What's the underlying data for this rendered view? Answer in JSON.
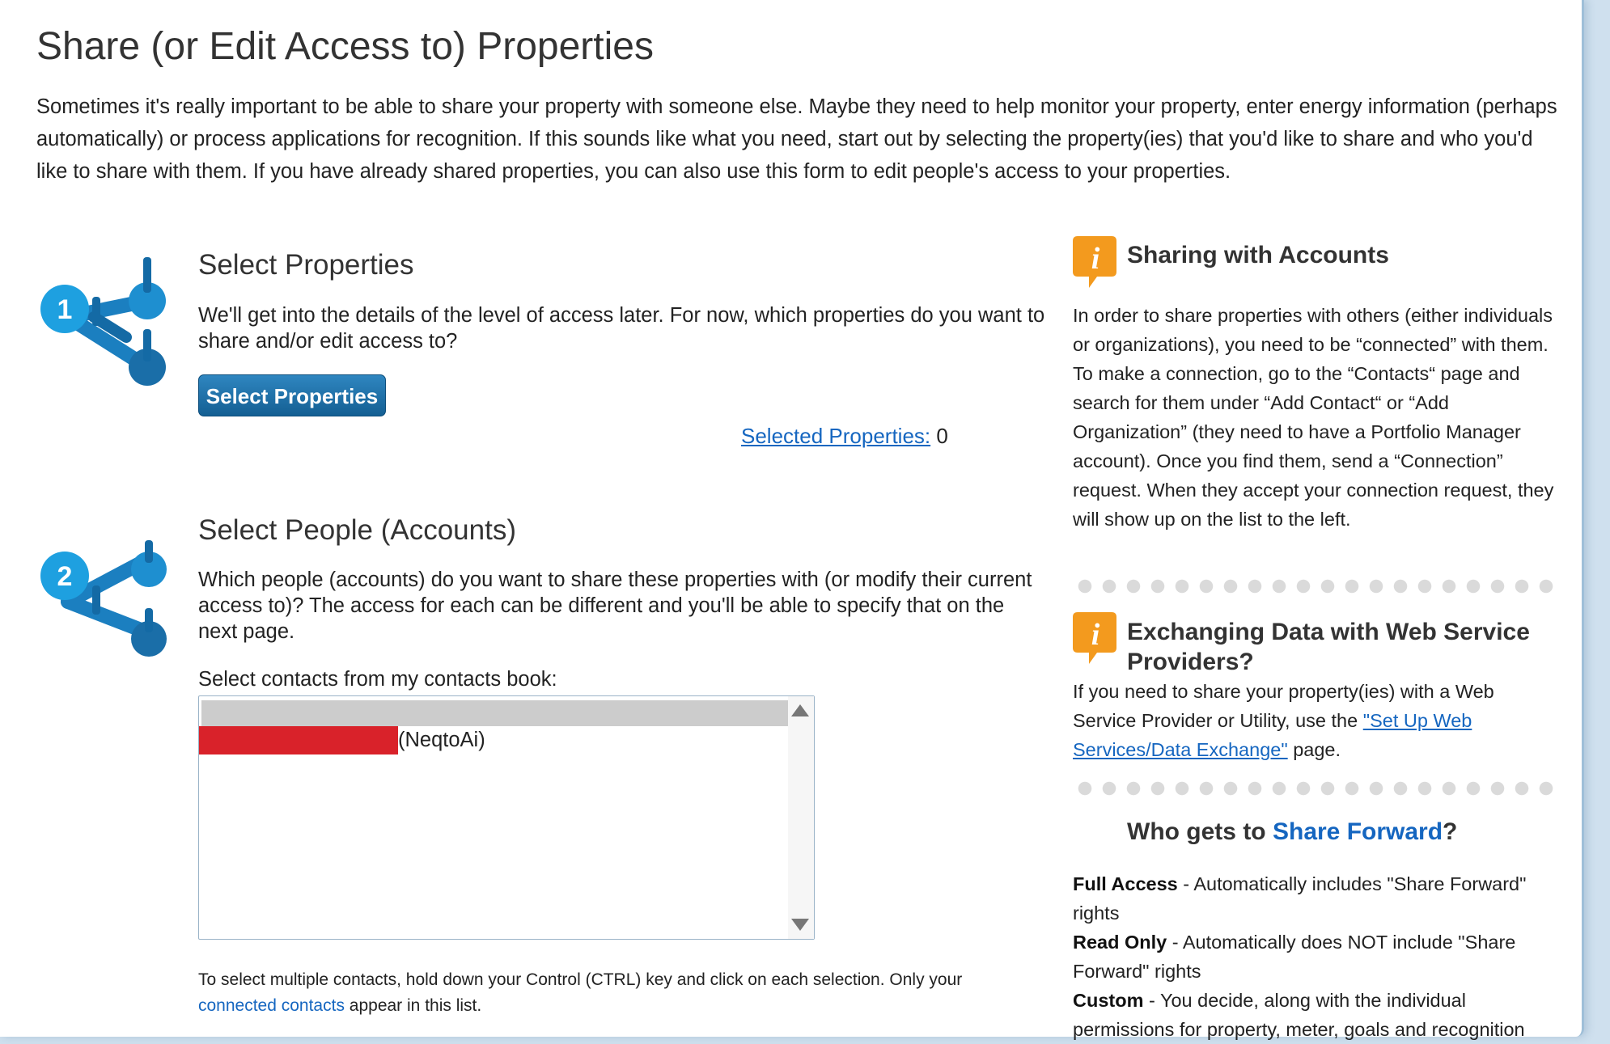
{
  "page": {
    "title": "Share (or Edit Access to) Properties",
    "intro": "Sometimes it's really important to be able to share your property with someone else. Maybe they need to help monitor your property, enter energy information (perhaps automatically) or process applications for recognition. If this sounds like what you need, start out by selecting the property(ies) that you'd like to share and who you'd like to share with them. If you have already shared properties, you can also use this form to edit people's access to your properties."
  },
  "step1": {
    "number": "1",
    "title": "Select Properties",
    "text": "We'll get into the details of the level of access later. For now, which properties do you want to share and/or edit access to?",
    "button_label": "Select Properties",
    "selected_link": "Selected Properties:",
    "selected_count": "0"
  },
  "step2": {
    "number": "2",
    "title": "Select People (Accounts)",
    "text": "Which people (accounts) do you want to share these properties with (or modify their current access to)? The access for each can be different and you'll be able to specify that on the next page.",
    "contacts_label": "Select contacts from my contacts book:",
    "contacts": [
      {
        "label": "(NeqtoAi)"
      }
    ],
    "footnote_before": "To select multiple contacts, hold down your Control (CTRL) key and click on each selection. Only your ",
    "footnote_link": "connected contacts",
    "footnote_after": " appear in this list."
  },
  "sidebar": {
    "sharing": {
      "title": "Sharing with Accounts",
      "text": "In order to share properties with others (either individuals or organizations), you need to be “connected” with them. To make a connection, go to the “Contacts“ page and search for them under “Add Contact“ or “Add Organization” (they need to have a Portfolio Manager account). Once you find them, send a “Connection” request. When they accept your connection request, they will show up on the list to the left."
    },
    "exchange": {
      "title": "Exchanging Data with Web Service Providers?",
      "text_before": "If you need to share your property(ies) with a Web Service Provider or Utility, use the ",
      "link": "\"Set Up Web Services/Data Exchange\"",
      "text_after": " page."
    },
    "share_forward": {
      "title_before": "Who gets to ",
      "title_link": "Share Forward",
      "title_after": "?",
      "items": [
        {
          "term": "Full Access",
          "desc": " - Automatically includes \"Share Forward\" rights"
        },
        {
          "term": "Read Only",
          "desc": " - Automatically does NOT include \"Share Forward\" rights"
        },
        {
          "term": "Custom",
          "desc": " - You decide, along with the individual permissions for property, meter, goals and recognition"
        }
      ]
    }
  },
  "colors": {
    "primary_blue": "#1566c0",
    "button_blue": "#145f93",
    "info_orange": "#f39a1e",
    "icon_blue": "#1e8fd0"
  },
  "icons": {
    "step": "share-network-icon",
    "info": "info-icon"
  }
}
